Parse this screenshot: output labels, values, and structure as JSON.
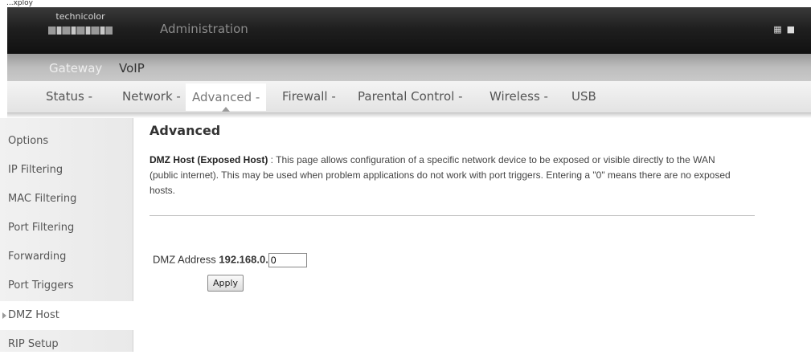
{
  "caption": "...xploy",
  "header": {
    "brand": "technicolor",
    "title": "Administration",
    "right_icons": [
      "language-icon",
      "window-icon"
    ]
  },
  "nav_primary": {
    "items": [
      {
        "label": "Gateway"
      },
      {
        "label": "VoIP"
      }
    ]
  },
  "nav_secondary": {
    "items": [
      {
        "label": "Status -"
      },
      {
        "label": "Network -"
      },
      {
        "label": "Advanced -",
        "active": true
      },
      {
        "label": "Firewall -"
      },
      {
        "label": "Parental Control -"
      },
      {
        "label": "Wireless -"
      },
      {
        "label": "USB"
      }
    ]
  },
  "sidebar": {
    "items": [
      {
        "label": "Options"
      },
      {
        "label": "IP Filtering"
      },
      {
        "label": "MAC Filtering"
      },
      {
        "label": "Port Filtering"
      },
      {
        "label": "Forwarding"
      },
      {
        "label": "Port Triggers"
      },
      {
        "label": "DMZ Host",
        "active": true
      },
      {
        "label": "RIP Setup"
      }
    ]
  },
  "main": {
    "heading": "Advanced",
    "desc_title": "DMZ Host (Exposed Host)",
    "desc_text": " :  This page allows configuration of a specific network device to be exposed or visible directly to the WAN (public internet). This may be used when problem applications do not work with port triggers. Entering a \"0\" means there are no exposed hosts.",
    "dmz_label": "DMZ Address",
    "dmz_prefix": "192.168.0.",
    "dmz_value": "0",
    "apply_label": "Apply"
  }
}
